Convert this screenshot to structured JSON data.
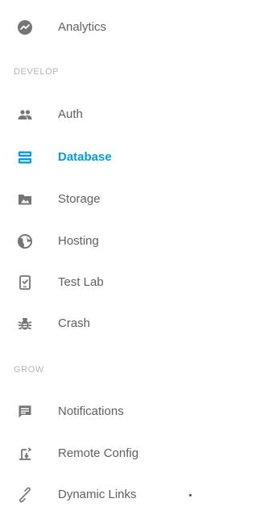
{
  "nav": {
    "analytics": {
      "label": "Analytics",
      "icon": "analytics-icon"
    },
    "develop_header": "DEVELOP",
    "develop_items": [
      {
        "label": "Auth",
        "icon": "people-icon"
      },
      {
        "label": "Database",
        "icon": "database-icon",
        "active": true
      },
      {
        "label": "Storage",
        "icon": "image-folder-icon"
      },
      {
        "label": "Hosting",
        "icon": "globe-icon"
      },
      {
        "label": "Test Lab",
        "icon": "test-lab-device-icon"
      },
      {
        "label": "Crash",
        "icon": "bug-icon"
      }
    ],
    "grow_header": "GROW",
    "grow_items": [
      {
        "label": "Notifications",
        "icon": "chat-message-icon"
      },
      {
        "label": "Remote Config",
        "icon": "remote-config-icon"
      },
      {
        "label": "Dynamic Links",
        "icon": "link-icon"
      }
    ]
  },
  "colors": {
    "active": "#039be5",
    "text": "#5f5f5f",
    "icon": "#757575",
    "section_header": "#b5b5b5"
  }
}
